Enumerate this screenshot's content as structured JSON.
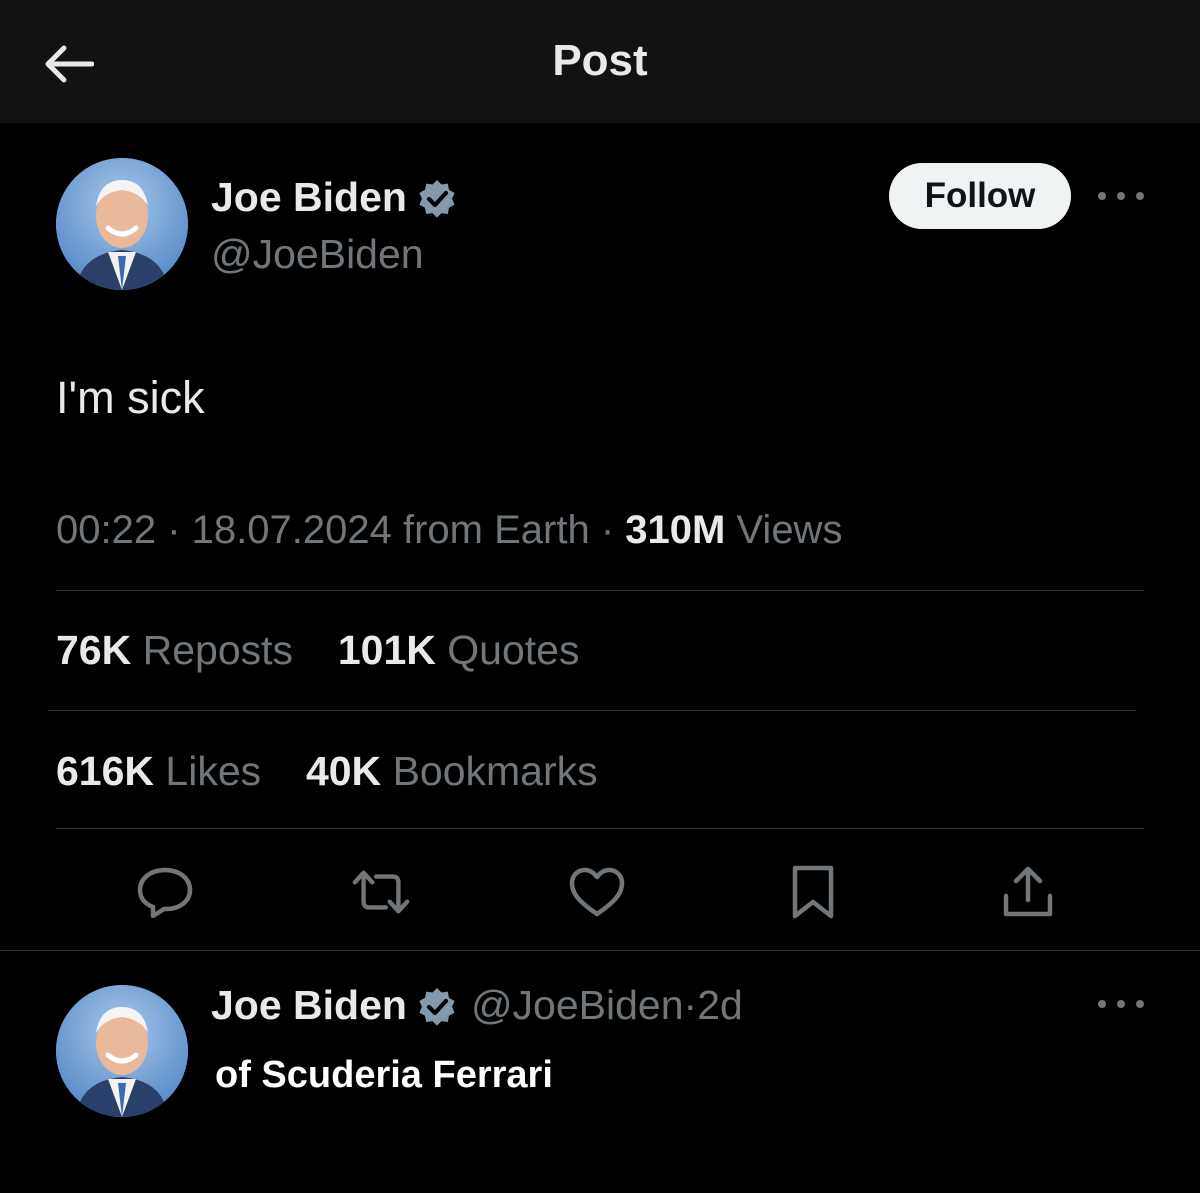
{
  "header": {
    "title": "Post",
    "back_icon": "arrow-left-icon"
  },
  "post": {
    "author_name": "Joe Biden",
    "author_handle": "@JoeBiden",
    "verified": true,
    "follow_label": "Follow",
    "text": "I'm sick",
    "time": "00:22",
    "date": "18.07.2024",
    "location": "from Earth",
    "views_count": "310M",
    "views_label": "Views",
    "reposts_count": "76K",
    "reposts_label": "Reposts",
    "quotes_count": "101K",
    "quotes_label": "Quotes",
    "likes_count": "616K",
    "likes_label": "Likes",
    "bookmarks_count": "40K",
    "bookmarks_label": "Bookmarks"
  },
  "reply": {
    "author_name": "Joe Biden",
    "author_handle": "@JoeBiden",
    "age": "2d",
    "text": "of Scuderia Ferrari"
  },
  "colors": {
    "background": "#000000",
    "header_bg": "#111213",
    "primary_text": "#e7e9ea",
    "secondary_text": "#71767b",
    "verified_badge": "#829aab",
    "divider": "#2f3336"
  },
  "icons": [
    "arrow-left-icon",
    "verified-badge-icon",
    "more-icon",
    "reply-icon",
    "repost-icon",
    "like-icon",
    "bookmark-icon",
    "share-icon"
  ]
}
